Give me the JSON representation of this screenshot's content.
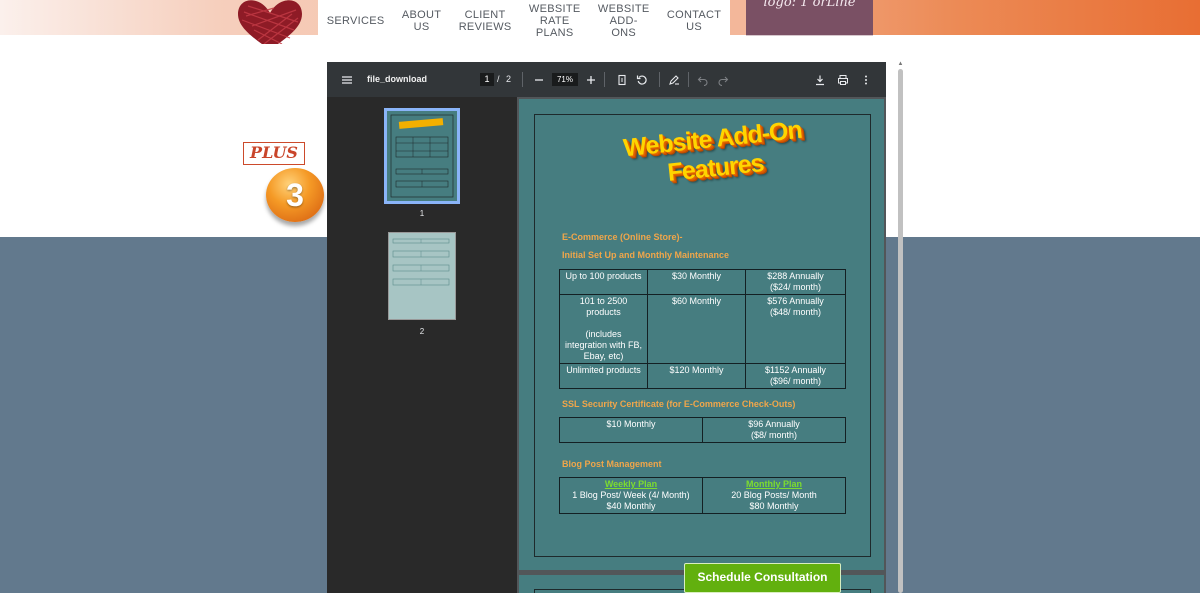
{
  "header": {
    "nav_items": [
      {
        "label": "SERVICES"
      },
      {
        "label": "ABOUT\nUS"
      },
      {
        "label": "CLIENT\nREVIEWS"
      },
      {
        "label": "WEBSITE\nRATE\nPLANS"
      },
      {
        "label": "WEBSITE\nADD-\nONS"
      },
      {
        "label": "CONTACT\nUS"
      }
    ],
    "cta_partial": "logo: 1 orLine"
  },
  "promo": {
    "plus_label": "PLUS",
    "number": "3"
  },
  "pdf_viewer": {
    "file_name": "file_download",
    "current_page": "1",
    "page_separator": "/",
    "total_pages": "2",
    "zoom": "71%",
    "icons": [
      "menu-icon",
      "zoom-out-icon",
      "zoom-in-icon",
      "fit-page-icon",
      "rotate-icon",
      "annotate-icon",
      "undo-icon",
      "redo-icon",
      "download-icon",
      "print-icon",
      "more-icon"
    ],
    "thumbnails": [
      {
        "label": "1"
      },
      {
        "label": "2"
      }
    ],
    "document": {
      "title": "Website Add-On Features",
      "ecommerce": {
        "heading": "E-Commerce (Online Store)-",
        "subheading": "Initial Set Up and Monthly Maintenance",
        "rows": [
          {
            "c1": "Up to 100 products",
            "c2": "$30 Monthly",
            "c3": "$288 Annually\n($24/ month)"
          },
          {
            "c1": "101 to 2500\nproducts\n\n(includes\nintegration with FB,\nEbay, etc)",
            "c2": "$60 Monthly",
            "c3": "$576 Annually\n($48/ month)"
          },
          {
            "c1": "Unlimited products",
            "c2": "$120 Monthly",
            "c3": "$1152 Annually\n($96/ month)"
          }
        ]
      },
      "ssl": {
        "heading": "SSL Security Certificate (for E-Commerce Check-Outs)",
        "c1": "$10 Monthly",
        "c2": "$96 Annually\n($8/ month)"
      },
      "blog": {
        "heading": "Blog Post Management",
        "weekly_title": "Weekly Plan",
        "weekly_detail": "1 Blog Post/ Week (4/ Month)\n$40 Monthly",
        "monthly_title": "Monthly Plan",
        "monthly_detail": "20 Blog Posts/ Month\n$80 Monthly"
      }
    }
  },
  "cta_button": "Schedule Consultation",
  "colors": {
    "page_teal": "#467d80",
    "heading_orange": "#f0a64a",
    "link_green": "#7ddc2f",
    "cta_green": "#62b00e",
    "slate_background": "#62798d"
  }
}
